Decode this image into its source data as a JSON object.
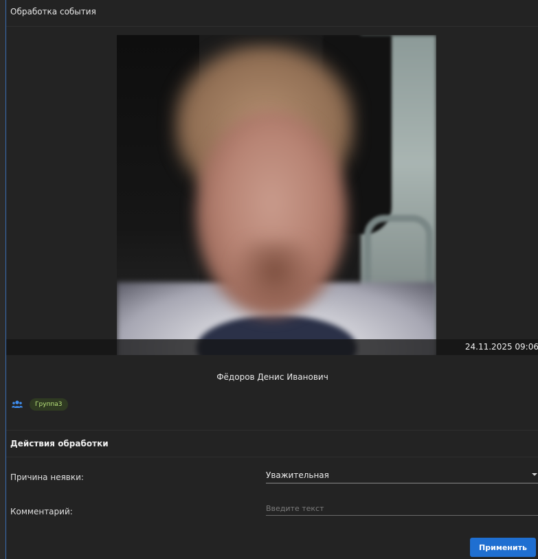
{
  "header": {
    "title": "Обработка события"
  },
  "photo": {
    "timestamp": "24.11.2025 09:06"
  },
  "person": {
    "name": "Фёдоров Денис Иванович"
  },
  "group": {
    "icon": "users-icon",
    "label": "Группа3",
    "badge_color": "#b8e37a"
  },
  "actions": {
    "title": "Действия обработки",
    "reason_label": "Причина неявки:",
    "reason_value": "Уважительная",
    "comment_label": "Комментарий:",
    "comment_placeholder": "Введите текст",
    "comment_value": "",
    "apply_label": "Применить"
  },
  "colors": {
    "accent": "#1f6fd1",
    "panel_bg": "#232323",
    "icon_blue": "#3f8ef0"
  }
}
